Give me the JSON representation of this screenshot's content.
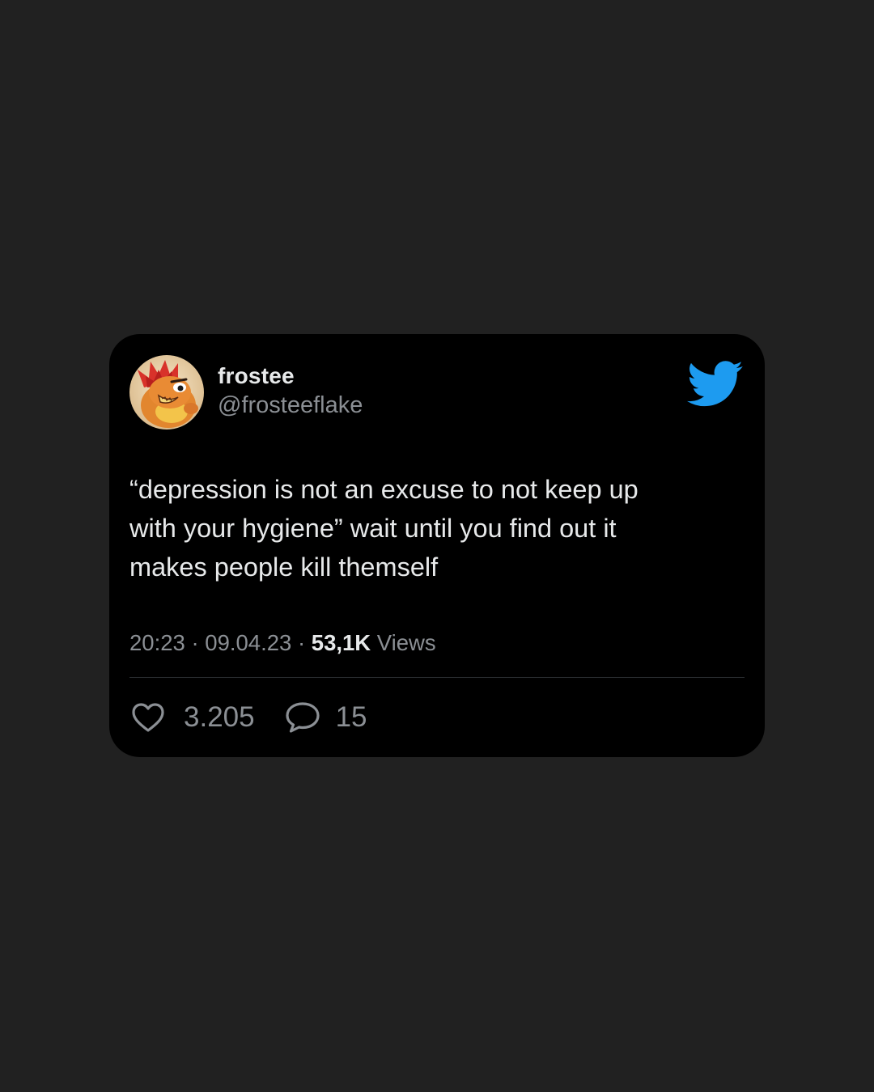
{
  "tweet": {
    "author": {
      "display_name": "frostee",
      "handle": "@frosteeflake",
      "avatar_icon": "fire-chick-avatar"
    },
    "platform_icon": "twitter-bird-icon",
    "text": "“depression is not an excuse to not keep up\nwith your hygiene” wait until you find out it\nmakes people kill themself",
    "meta": {
      "time": "20:23",
      "separator": " · ",
      "date": "09.04.23",
      "views_count": "53,1K",
      "views_label": " Views"
    },
    "stats": {
      "likes": "3.205",
      "replies": "15"
    }
  },
  "colors": {
    "background": "#212121",
    "card": "#000000",
    "primary_text": "#e7e9ea",
    "secondary_text": "#8b8f94",
    "twitter_blue": "#1d9bf0"
  }
}
